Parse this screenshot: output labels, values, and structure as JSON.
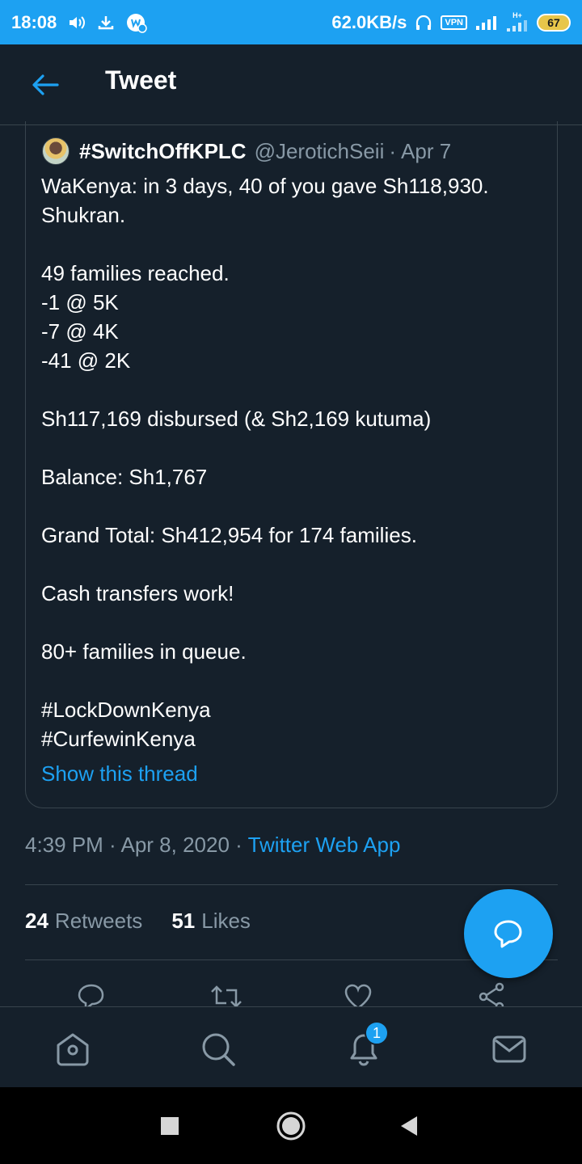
{
  "status_bar": {
    "time": "18:08",
    "speed": "62.0KB/s",
    "vpn": "VPN",
    "network": "H+",
    "battery": "67",
    "icons": [
      "volume-icon",
      "download-icon",
      "app-notification-icon",
      "headset-icon",
      "vpn-icon",
      "signal-icon",
      "signal-h-plus-icon",
      "battery-icon"
    ]
  },
  "header": {
    "title": "Tweet",
    "back_icon": "back-arrow-icon"
  },
  "quoted_tweet": {
    "name": "#SwitchOffKPLC",
    "handle": "@JerotichSeii",
    "separator": "·",
    "date": "Apr 7",
    "lines": [
      "WaKenya: in 3 days, 40 of you gave Sh118,930.",
      "Shukran.",
      "",
      "49 families reached.",
      "-1 @ 5K",
      "-7 @ 4K",
      "-41 @ 2K",
      "",
      "Sh117,169 disbursed (& Sh2,169 kutuma)",
      "",
      "Balance: Sh1,767",
      "",
      "Grand Total: Sh412,954 for 174 families.",
      "",
      "Cash transfers work!",
      "",
      "80+ families in queue.",
      "",
      "#LockDownKenya",
      "#CurfewinKenya"
    ],
    "show_thread": "Show this thread"
  },
  "meta": {
    "time": "4:39 PM",
    "sep1": " · ",
    "date": "Apr 8, 2020",
    "sep2": " · ",
    "app": "Twitter Web App"
  },
  "stats": {
    "retweets_count": "24",
    "retweets_label": "Retweets",
    "likes_count": "51",
    "likes_label": "Likes"
  },
  "actions": [
    "reply-icon",
    "retweet-icon",
    "like-icon",
    "share-icon"
  ],
  "fab": {
    "icon": "compose-reply-icon"
  },
  "bottom_nav": {
    "items": [
      "home-icon",
      "search-icon",
      "notifications-icon",
      "messages-icon"
    ],
    "notification_badge": "1"
  },
  "system_nav": [
    "recent-apps-icon",
    "home-button-icon",
    "back-button-icon"
  ],
  "colors": {
    "background": "#15202b",
    "accent": "#1da1f2",
    "secondary_text": "#8899a6",
    "border": "#38444d"
  }
}
